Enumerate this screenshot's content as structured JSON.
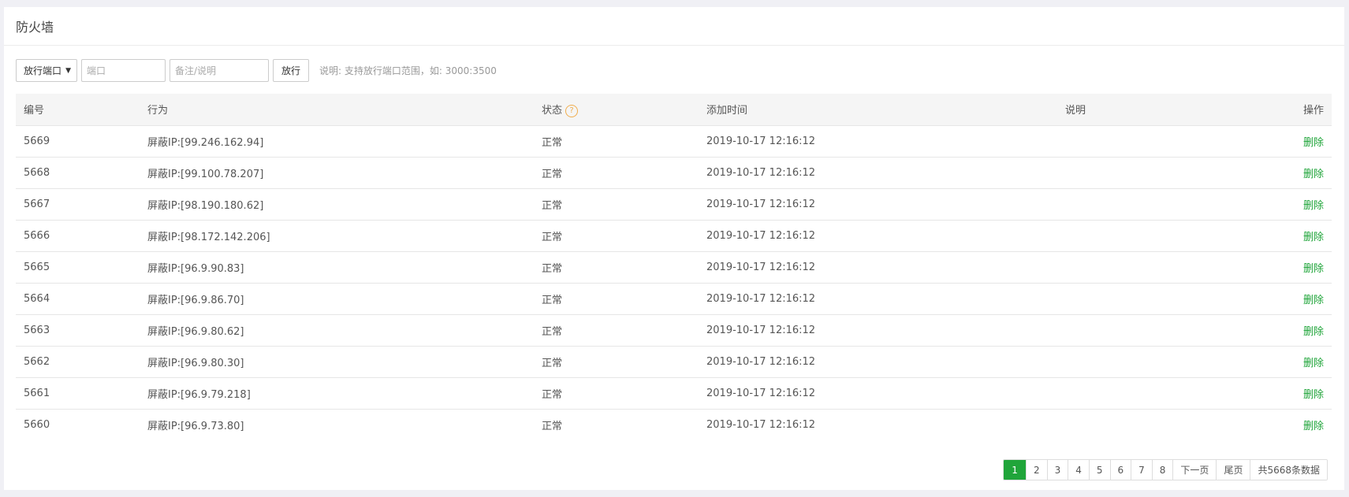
{
  "title": "防火墙",
  "toolbar": {
    "select_value": "放行端口",
    "port_placeholder": "端口",
    "note_placeholder": "备注/说明",
    "submit_label": "放行",
    "hint": "说明: 支持放行端口范围，如: 3000:3500"
  },
  "table": {
    "headers": {
      "id": "编号",
      "action": "行为",
      "status": "状态",
      "time": "添加时间",
      "remark": "说明",
      "op": "操作"
    },
    "rows": [
      {
        "id": "5669",
        "action": "屏蔽IP:[99.246.162.94]",
        "status": "正常",
        "time": "2019-10-17 12:16:12",
        "remark": "",
        "op": "删除"
      },
      {
        "id": "5668",
        "action": "屏蔽IP:[99.100.78.207]",
        "status": "正常",
        "time": "2019-10-17 12:16:12",
        "remark": "",
        "op": "删除"
      },
      {
        "id": "5667",
        "action": "屏蔽IP:[98.190.180.62]",
        "status": "正常",
        "time": "2019-10-17 12:16:12",
        "remark": "",
        "op": "删除"
      },
      {
        "id": "5666",
        "action": "屏蔽IP:[98.172.142.206]",
        "status": "正常",
        "time": "2019-10-17 12:16:12",
        "remark": "",
        "op": "删除"
      },
      {
        "id": "5665",
        "action": "屏蔽IP:[96.9.90.83]",
        "status": "正常",
        "time": "2019-10-17 12:16:12",
        "remark": "",
        "op": "删除"
      },
      {
        "id": "5664",
        "action": "屏蔽IP:[96.9.86.70]",
        "status": "正常",
        "time": "2019-10-17 12:16:12",
        "remark": "",
        "op": "删除"
      },
      {
        "id": "5663",
        "action": "屏蔽IP:[96.9.80.62]",
        "status": "正常",
        "time": "2019-10-17 12:16:12",
        "remark": "",
        "op": "删除"
      },
      {
        "id": "5662",
        "action": "屏蔽IP:[96.9.80.30]",
        "status": "正常",
        "time": "2019-10-17 12:16:12",
        "remark": "",
        "op": "删除"
      },
      {
        "id": "5661",
        "action": "屏蔽IP:[96.9.79.218]",
        "status": "正常",
        "time": "2019-10-17 12:16:12",
        "remark": "",
        "op": "删除"
      },
      {
        "id": "5660",
        "action": "屏蔽IP:[96.9.73.80]",
        "status": "正常",
        "time": "2019-10-17 12:16:12",
        "remark": "",
        "op": "删除"
      }
    ]
  },
  "pagination": {
    "pages": [
      "1",
      "2",
      "3",
      "4",
      "5",
      "6",
      "7",
      "8"
    ],
    "current": "1",
    "next": "下一页",
    "last": "尾页",
    "total": "共5668条数据"
  },
  "colors": {
    "accent": "#20a53a",
    "help_icon": "#f0ad4e"
  },
  "icons": {
    "select_caret": "caret-down-icon",
    "status_help": "question-circle-icon"
  }
}
